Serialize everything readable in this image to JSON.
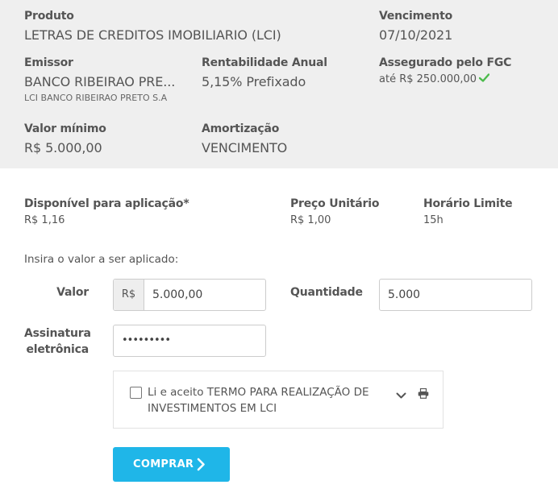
{
  "produto": {
    "label": "Produto",
    "value": "LETRAS DE CREDITOS IMOBILIARIO (LCI)"
  },
  "vencimento": {
    "label": "Vencimento",
    "value": "07/10/2021"
  },
  "emissor": {
    "label": "Emissor",
    "value": "BANCO RIBEIRAO PRE...",
    "sub": "LCI BANCO RIBEIRAO PRETO S.A"
  },
  "rentabilidade": {
    "label": "Rentabilidade Anual",
    "value": "5,15% Prefixado"
  },
  "fgc": {
    "label": "Assegurado pelo FGC",
    "value": "até R$ 250.000,00",
    "icon": "check-icon",
    "icon_color": "#4cbb4c"
  },
  "valor_minimo": {
    "label": "Valor mínimo",
    "value": "R$ 5.000,00"
  },
  "amortizacao": {
    "label": "Amortização",
    "value": "VENCIMENTO"
  },
  "disponivel": {
    "label": "Disponível para aplicação*",
    "value": "R$ 1,16"
  },
  "preco_unitario": {
    "label": "Preço Unitário",
    "value": "R$ 1,00"
  },
  "horario_limite": {
    "label": "Horário Limite",
    "value": "15h"
  },
  "form": {
    "instruction": "Insira o valor a ser aplicado:",
    "valor_label": "Valor",
    "currency_addon": "R$",
    "valor_value": "5.000,00",
    "quantidade_label": "Quantidade",
    "quantidade_value": "5.000",
    "assinatura_label_line1": "Assinatura",
    "assinatura_label_line2": "eletrônica",
    "assinatura_value": "•••••••••"
  },
  "terms": {
    "text": "Li e aceito TERMO PARA REALIZAÇÃO DE INVESTIMENTOS EM LCI",
    "checked": false,
    "expand_icon": "chevron-down-icon",
    "print_icon": "printer-icon"
  },
  "buy_button": {
    "label": "COMPRAR",
    "icon": "chevron-right-icon",
    "color": "#1fb6e8"
  }
}
